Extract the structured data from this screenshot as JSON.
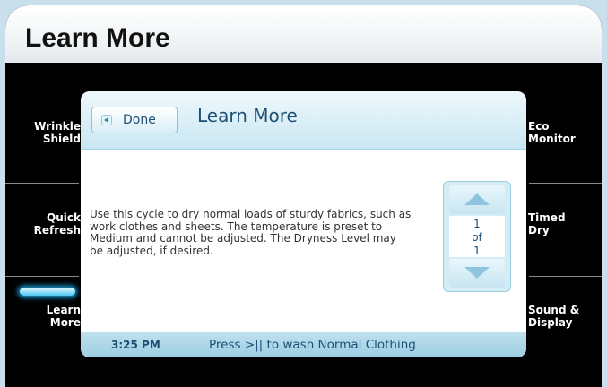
{
  "header": {
    "title": "Learn More"
  },
  "left_menu": {
    "wrinkle_shield": [
      "Wrinkle",
      "Shield"
    ],
    "quick_refresh": [
      "Quick",
      "Refresh"
    ],
    "learn_more": [
      "Learn",
      "More"
    ]
  },
  "right_menu": {
    "eco_monitor": [
      "Eco",
      "Monitor"
    ],
    "timed_dry": [
      "Timed",
      "Dry"
    ],
    "sound_display": [
      "Sound &",
      "Display"
    ]
  },
  "dialog": {
    "done_label": "Done",
    "back_icon": "left-triangle-icon",
    "title": "Learn More",
    "body": "Use this cycle to dry normal loads of sturdy fabrics, such as work clothes and sheets. The temperature is preset to Medium and cannot be adjusted. The Dryness Level may be adjusted, if desired.",
    "pager": {
      "current": "1",
      "of": "of",
      "total": "1",
      "up_icon": "up-triangle-icon",
      "down_icon": "down-triangle-icon"
    }
  },
  "status": {
    "time": "3:25 PM",
    "message": "Press >|| to wash Normal Clothing"
  },
  "colors": {
    "accent": "#1d4f74",
    "highlight": "#49c7f0",
    "dialog_header": "#c9e7f3"
  }
}
